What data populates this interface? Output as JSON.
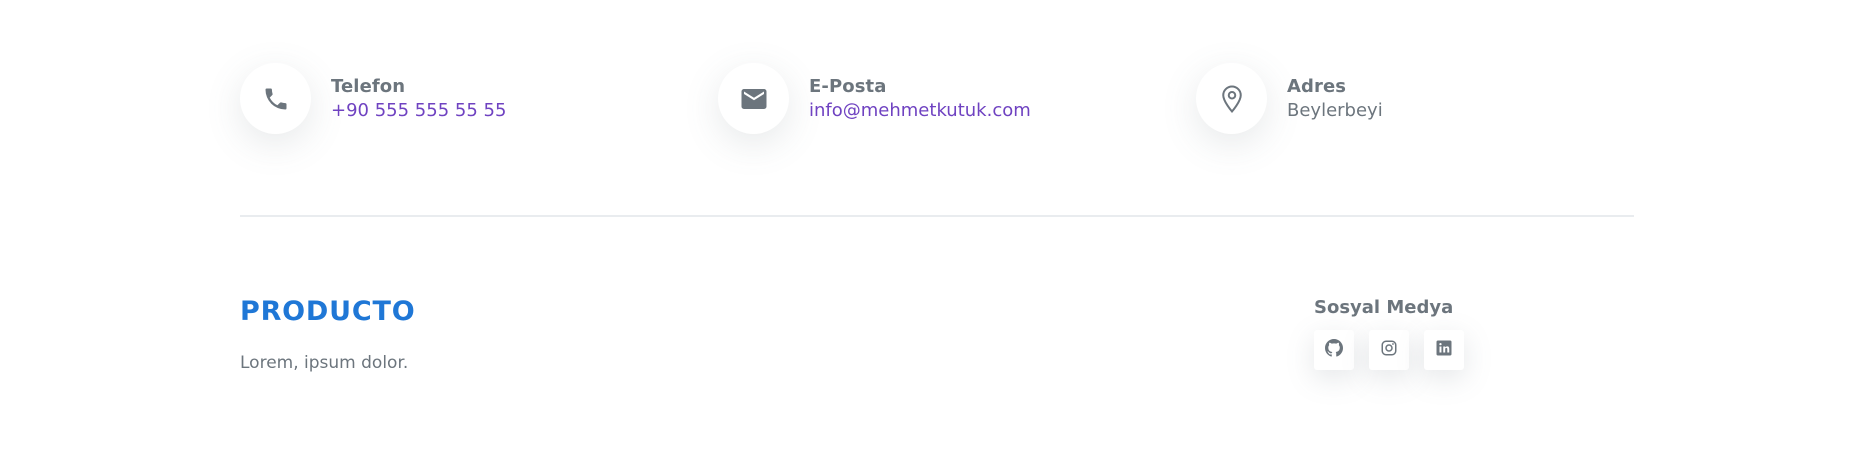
{
  "contact": {
    "phone": {
      "label": "Telefon",
      "value": "+90 555 555 55 55",
      "icon": "phone-icon"
    },
    "email": {
      "label": "E-Posta",
      "value": "info@mehmetkutuk.com",
      "icon": "envelope-icon"
    },
    "address": {
      "label": "Adres",
      "value": "Beylerbeyi",
      "icon": "map-pin-icon"
    }
  },
  "footer": {
    "brand": "PRODUCTO",
    "tagline": "Lorem, ipsum dolor.",
    "social": {
      "title": "Sosyal Medya",
      "items": [
        {
          "name": "github",
          "icon": "github-icon"
        },
        {
          "name": "instagram",
          "icon": "instagram-icon"
        },
        {
          "name": "linkedin",
          "icon": "linkedin-icon"
        }
      ]
    }
  },
  "colors": {
    "accent_link": "#6f42c1",
    "brand": "#1f77d6",
    "muted_text": "#6c757d",
    "divider": "#e9ecef"
  }
}
